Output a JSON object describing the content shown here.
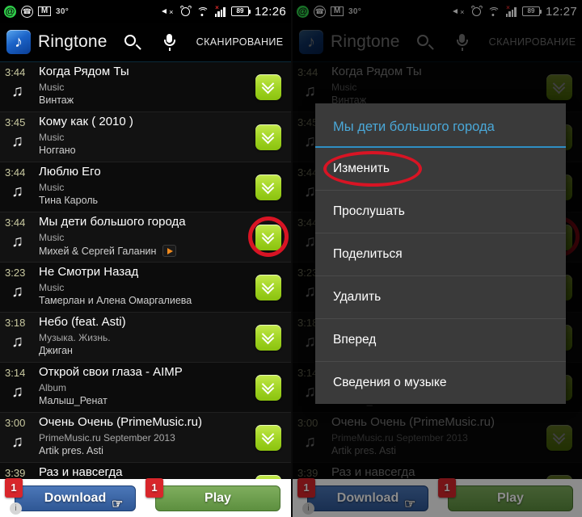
{
  "left": {
    "statusbar": {
      "icons": [
        "at-circle-icon",
        "viber-icon",
        "gmail-icon"
      ],
      "temperature": "30°",
      "right_icons": [
        "mute-icon",
        "alarm-icon",
        "wifi-icon",
        "signal-icon"
      ],
      "battery": "89",
      "time": "12:26"
    },
    "header": {
      "app_title": "Ringtone",
      "search_icon": "search-icon",
      "mic_icon": "microphone-icon",
      "scan_label": "СКАНИРОВАНИЕ"
    },
    "tracks": [
      {
        "duration": "3:44",
        "title": "Когда Рядом Ты",
        "album": "Music",
        "artist": "Винтаж",
        "has_play_badge": false,
        "highlighted": false
      },
      {
        "duration": "3:45",
        "title": "Кому как ( 2010 )",
        "album": "Music",
        "artist": "Ноггано",
        "has_play_badge": false,
        "highlighted": false
      },
      {
        "duration": "3:44",
        "title": "Люблю Его",
        "album": "Music",
        "artist": "Тина Кароль",
        "has_play_badge": false,
        "highlighted": false
      },
      {
        "duration": "3:44",
        "title": "Мы дети большого города",
        "album": "Music",
        "artist": "Михей & Сергей Галанин",
        "has_play_badge": true,
        "highlighted": true
      },
      {
        "duration": "3:23",
        "title": "Не Смотри Назад",
        "album": "Music",
        "artist": "Тамерлан и Алена Омаргалиева",
        "has_play_badge": false,
        "highlighted": false
      },
      {
        "duration": "3:18",
        "title": "Небо (feat. Asti)",
        "album": "Музыка. Жизнь.",
        "artist": "Джиган",
        "has_play_badge": false,
        "highlighted": false
      },
      {
        "duration": "3:14",
        "title": "Открой свои глаза - AIMP",
        "album": "Album",
        "artist": "Малыш_Ренат",
        "has_play_badge": false,
        "highlighted": false
      },
      {
        "duration": "3:00",
        "title": "Очень Очень (PrimeMusic.ru)",
        "album": "PrimeMusic.ru September 2013",
        "artist": "Artik pres. Asti",
        "has_play_badge": false,
        "highlighted": false
      },
      {
        "duration": "3:39",
        "title": "Раз и навсегда",
        "album": "",
        "artist": "",
        "has_play_badge": false,
        "highlighted": false
      }
    ],
    "banner": {
      "download_label": "Download",
      "download_badge": "1",
      "play_label": "Play",
      "play_badge": "1"
    }
  },
  "right": {
    "statusbar": {
      "temperature": "30°",
      "battery": "89",
      "time": "12:27"
    },
    "header": {
      "app_title": "Ringtone",
      "scan_label": "СКАНИРОВАНИЕ"
    },
    "dialog": {
      "title": "Мы дети большого города",
      "items": [
        {
          "label": "Изменить",
          "highlighted": true
        },
        {
          "label": "Прослушать",
          "highlighted": false
        },
        {
          "label": "Поделиться",
          "highlighted": false
        },
        {
          "label": "Удалить",
          "highlighted": false
        },
        {
          "label": "Вперед",
          "highlighted": false
        },
        {
          "label": "Сведения о музыке",
          "highlighted": false
        }
      ]
    }
  },
  "colors": {
    "accent_green": "#9fd321",
    "dialog_title": "#4aa8d8",
    "annotation_red": "#d81424",
    "download_blue": "#2f5795",
    "play_green": "#5d8f3f"
  }
}
